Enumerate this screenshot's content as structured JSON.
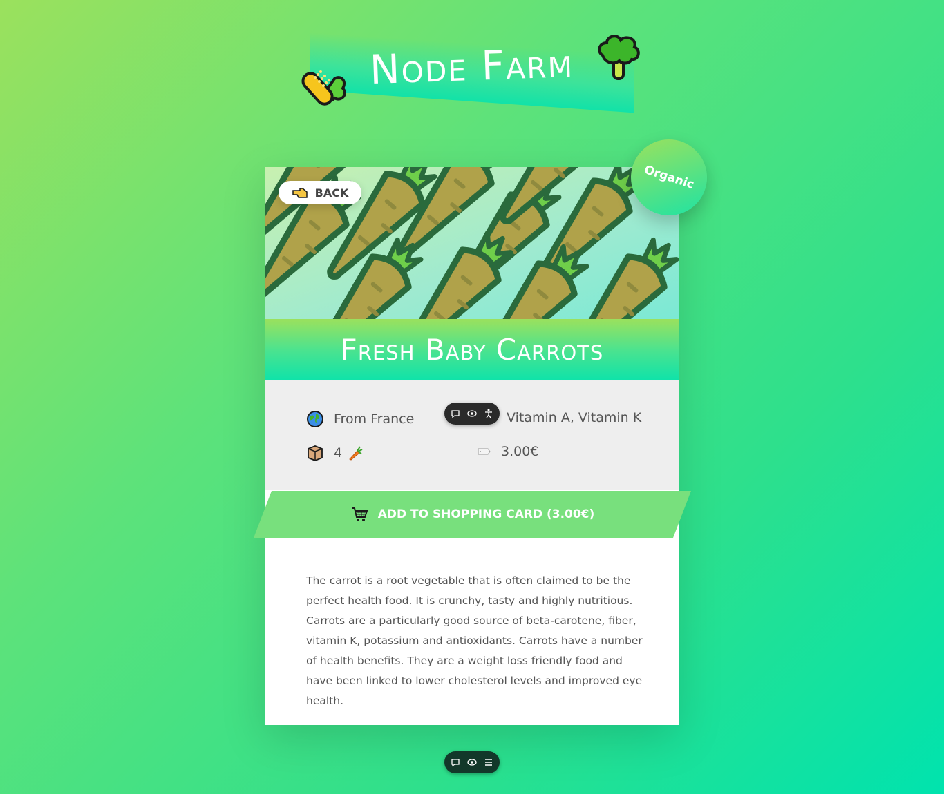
{
  "header": {
    "brand": "Node Farm"
  },
  "product": {
    "badge": "Organic",
    "back_label": "BACK",
    "name": "Fresh Baby Carrots",
    "origin": "From France",
    "nutrients": "Vitamin A, Vitamin K",
    "quantity": "4",
    "price": "3.00€",
    "add_to_cart_label": "ADD TO SHOPPING CARD (3.00€)",
    "description": "The carrot is a root vegetable that is often claimed to be the perfect health food. It is crunchy, tasty and highly nutritious. Carrots are a particularly good source of beta-carotene, fiber, vitamin K, potassium and antioxidants. Carrots have a number of health benefits. They are a weight loss friendly food and have been linked to lower cholesterol levels and improved eye health."
  },
  "icons": {
    "corn": "corn-icon",
    "broccoli": "broccoli-icon",
    "back": "pointing-hand-icon",
    "origin": "globe-icon",
    "quantity": "box-icon",
    "quantity_item": "carrot-icon",
    "price": "price-tag-icon",
    "cart": "shopping-cart-icon"
  },
  "colors": {
    "accent_green": "#78e07d",
    "teal": "#10e3a9",
    "card_info_bg": "#eeeeee"
  }
}
